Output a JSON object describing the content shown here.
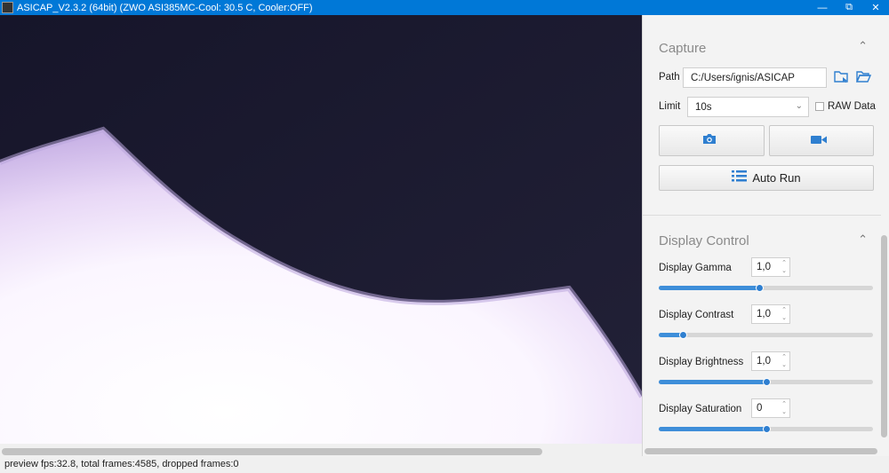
{
  "window": {
    "title": "ASICAP_V2.3.2 (64bit) (ZWO ASI385MC-Cool: 30.5 C, Cooler:OFF)",
    "minimize": "—",
    "maximize": "⧉",
    "close": "✕"
  },
  "status": "preview fps:32.8, total frames:4585, dropped frames:0",
  "capture": {
    "heading": "Capture",
    "path_label": "Path",
    "path_value": "C:/Users/ignis/ASICAP",
    "limit_label": "Limit",
    "limit_value": "10s",
    "raw_label": "RAW Data",
    "raw_checked": false,
    "auto_run_label": "Auto Run"
  },
  "display_control": {
    "heading": "Display Control",
    "controls": [
      {
        "label": "Display Gamma",
        "value": "1,0",
        "slider_fraction": 0.47
      },
      {
        "label": "Display Contrast",
        "value": "1,0",
        "slider_fraction": 0.11
      },
      {
        "label": "Display Brightness",
        "value": "1,0",
        "slider_fraction": 0.5
      },
      {
        "label": "Display Saturation",
        "value": "0",
        "slider_fraction": 0.5
      }
    ]
  },
  "icons": {
    "collapse": "chevron-up-icon",
    "select_path": "folder-select-icon",
    "open_folder": "folder-open-icon",
    "snapshot": "camera-icon",
    "record": "video-camera-icon",
    "auto_run": "list-icon"
  },
  "colors": {
    "accent": "#2f7fd0",
    "titlebar": "#0078d7"
  }
}
